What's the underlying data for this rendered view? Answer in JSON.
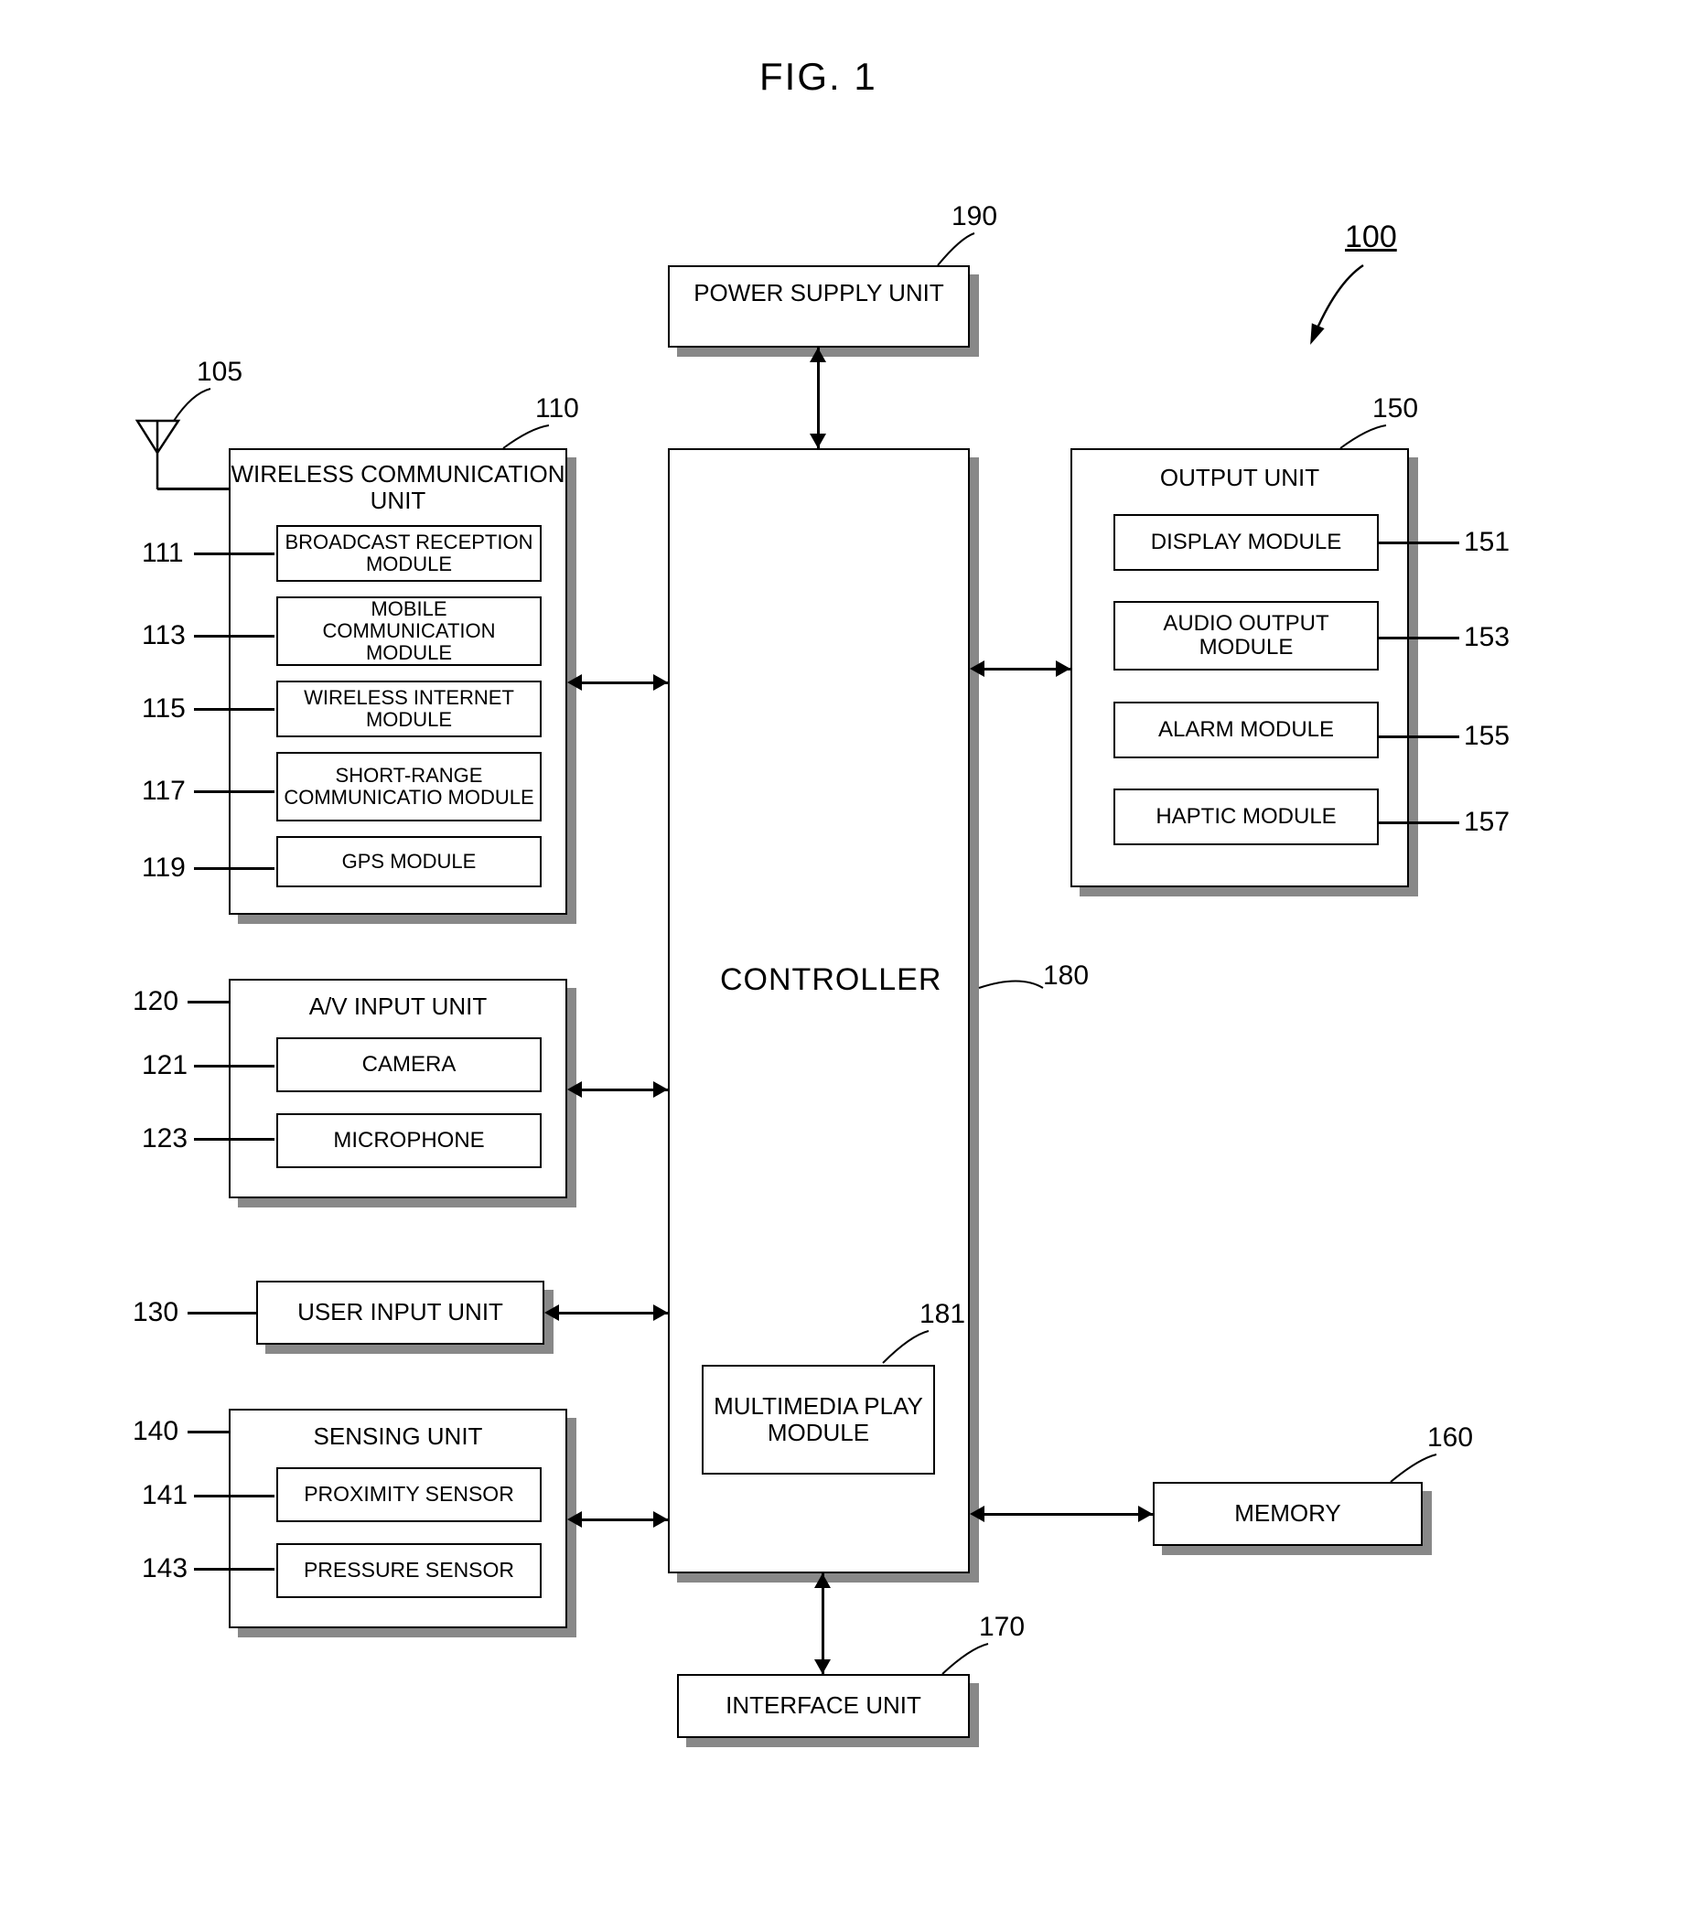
{
  "figure": {
    "title": "FIG. 1"
  },
  "system_ref": "100",
  "antenna_ref": "105",
  "power": {
    "label": "POWER SUPPLY UNIT",
    "ref": "190"
  },
  "wireless": {
    "title": "WIRELESS COMMUNICATION UNIT",
    "ref": "110",
    "items": [
      {
        "label": "BROADCAST RECEPTION MODULE",
        "ref": "111"
      },
      {
        "label": "MOBILE COMMUNICATION MODULE",
        "ref": "113"
      },
      {
        "label": "WIRELESS INTERNET MODULE",
        "ref": "115"
      },
      {
        "label": "SHORT-RANGE COMMUNICATIO MODULE",
        "ref": "117"
      },
      {
        "label": "GPS MODULE",
        "ref": "119"
      }
    ]
  },
  "av": {
    "title": "A/V INPUT UNIT",
    "ref": "120",
    "items": [
      {
        "label": "CAMERA",
        "ref": "121"
      },
      {
        "label": "MICROPHONE",
        "ref": "123"
      }
    ]
  },
  "user_input": {
    "label": "USER INPUT UNIT",
    "ref": "130"
  },
  "sensing": {
    "title": "SENSING UNIT",
    "ref": "140",
    "items": [
      {
        "label": "PROXIMITY SENSOR",
        "ref": "141"
      },
      {
        "label": "PRESSURE SENSOR",
        "ref": "143"
      }
    ]
  },
  "controller": {
    "label": "CONTROLLER",
    "ref": "180",
    "mm": {
      "label": "MULTIMEDIA PLAY MODULE",
      "ref": "181"
    }
  },
  "output": {
    "title": "OUTPUT UNIT",
    "ref": "150",
    "items": [
      {
        "label": "DISPLAY MODULE",
        "ref": "151"
      },
      {
        "label": "AUDIO OUTPUT MODULE",
        "ref": "153"
      },
      {
        "label": "ALARM MODULE",
        "ref": "155"
      },
      {
        "label": "HAPTIC MODULE",
        "ref": "157"
      }
    ]
  },
  "memory": {
    "label": "MEMORY",
    "ref": "160"
  },
  "interface": {
    "label": "INTERFACE UNIT",
    "ref": "170"
  }
}
